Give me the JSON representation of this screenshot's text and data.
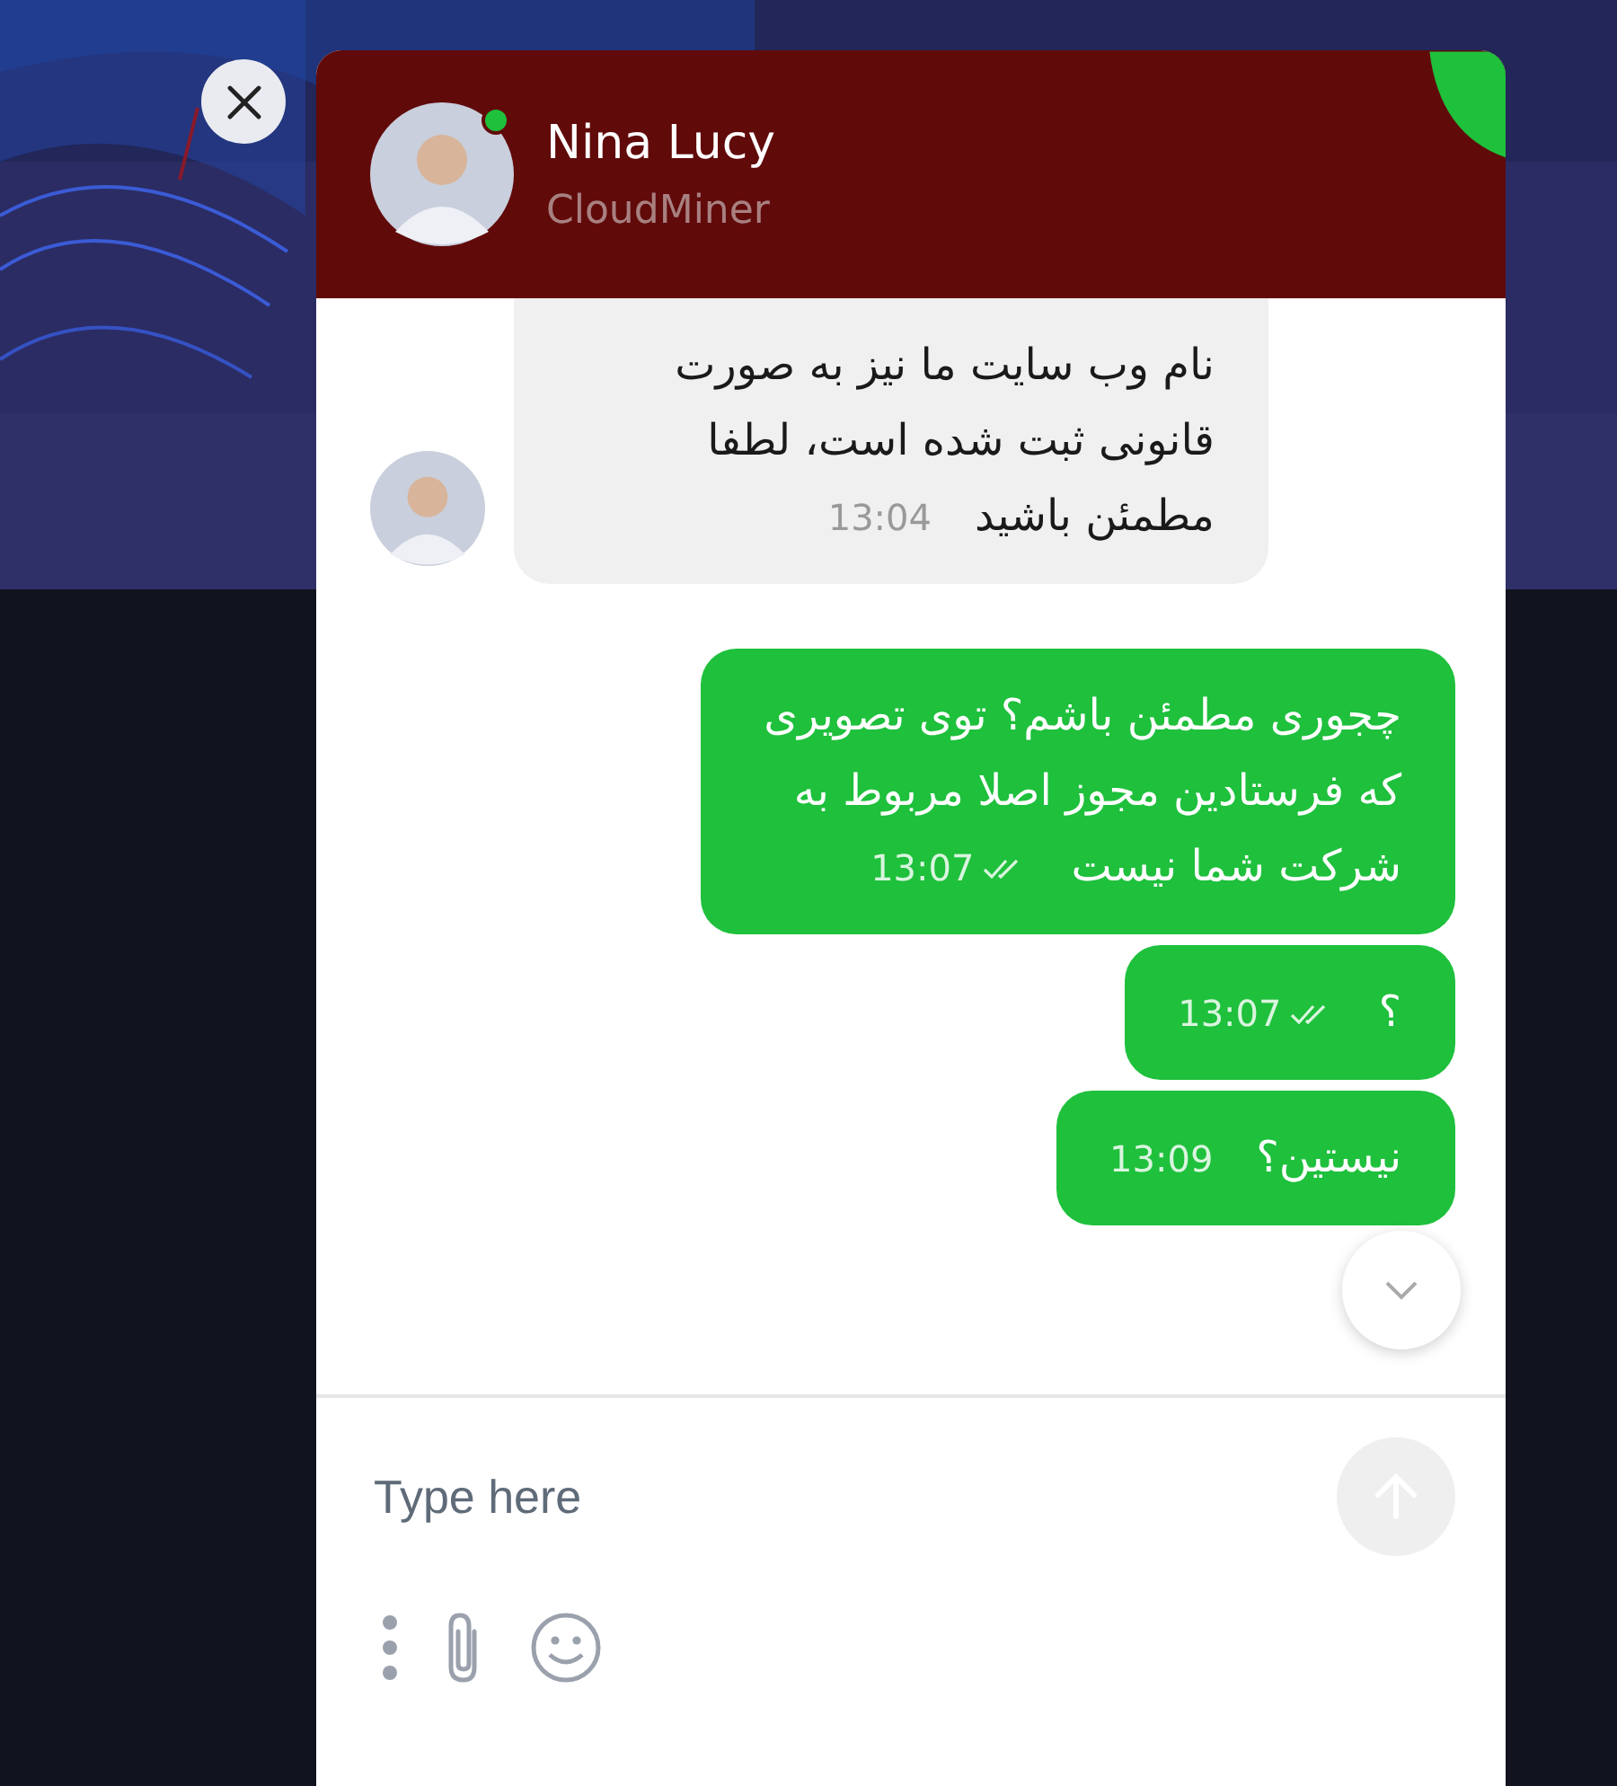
{
  "agent": {
    "name": "Nina Lucy",
    "company": "CloudMiner",
    "online": true
  },
  "messages": [
    {
      "kind": "incoming",
      "text": "نام وب سایت ما نیز به صورت قانونی ثبت شده است، لطفا مطمئن باشید",
      "time": "13:04"
    },
    {
      "kind": "outgoing",
      "text": "چجوری مطمئن باشم؟ توی تصویری که فرستادین مجوز اصلا مربوط به شرکت شما نیست",
      "time": "13:07",
      "read": true
    },
    {
      "kind": "outgoing",
      "text": "؟",
      "time": "13:07",
      "read": true
    },
    {
      "kind": "outgoing",
      "text": "نیستین؟",
      "time": "13:09"
    }
  ],
  "composer": {
    "placeholder": "Type here"
  }
}
